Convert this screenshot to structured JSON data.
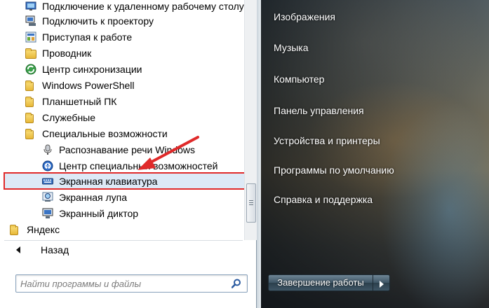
{
  "programs": {
    "items": [
      {
        "label": "Подключение к удаленному рабочему столу",
        "icon": "remote-desktop-icon"
      },
      {
        "label": "Подключить к проектору",
        "icon": "projector-icon"
      },
      {
        "label": "Приступая к работе",
        "icon": "getting-started-icon"
      },
      {
        "label": "Проводник",
        "icon": "explorer-icon"
      },
      {
        "label": "Центр синхронизации",
        "icon": "sync-center-icon"
      },
      {
        "label": "Windows PowerShell",
        "icon": "folder-icon"
      },
      {
        "label": "Планшетный ПК",
        "icon": "folder-icon"
      },
      {
        "label": "Служебные",
        "icon": "folder-icon"
      },
      {
        "label": "Специальные возможности",
        "icon": "folder-icon"
      },
      {
        "label": "Распознавание речи Windows",
        "icon": "microphone-icon"
      },
      {
        "label": "Центр специальных возможностей",
        "icon": "ease-of-access-icon"
      },
      {
        "label": "Экранная клавиатура",
        "icon": "keyboard-icon",
        "selected": true
      },
      {
        "label": "Экранная лупа",
        "icon": "magnifier-icon"
      },
      {
        "label": "Экранный диктор",
        "icon": "narrator-icon"
      },
      {
        "label": "Яндекс",
        "icon": "folder-icon"
      }
    ]
  },
  "back_label": "Назад",
  "search": {
    "placeholder": "Найти программы и файлы"
  },
  "right_menu": {
    "items": [
      "Изображения",
      "Музыка",
      "Компьютер",
      "Панель управления",
      "Устройства и принтеры",
      "Программы по умолчанию",
      "Справка и поддержка"
    ]
  },
  "shutdown_label": "Завершение работы",
  "colors": {
    "highlight_border": "#e02a2a",
    "annotation_arrow": "#e02a2a",
    "selection_fill": "#dde9f6"
  }
}
